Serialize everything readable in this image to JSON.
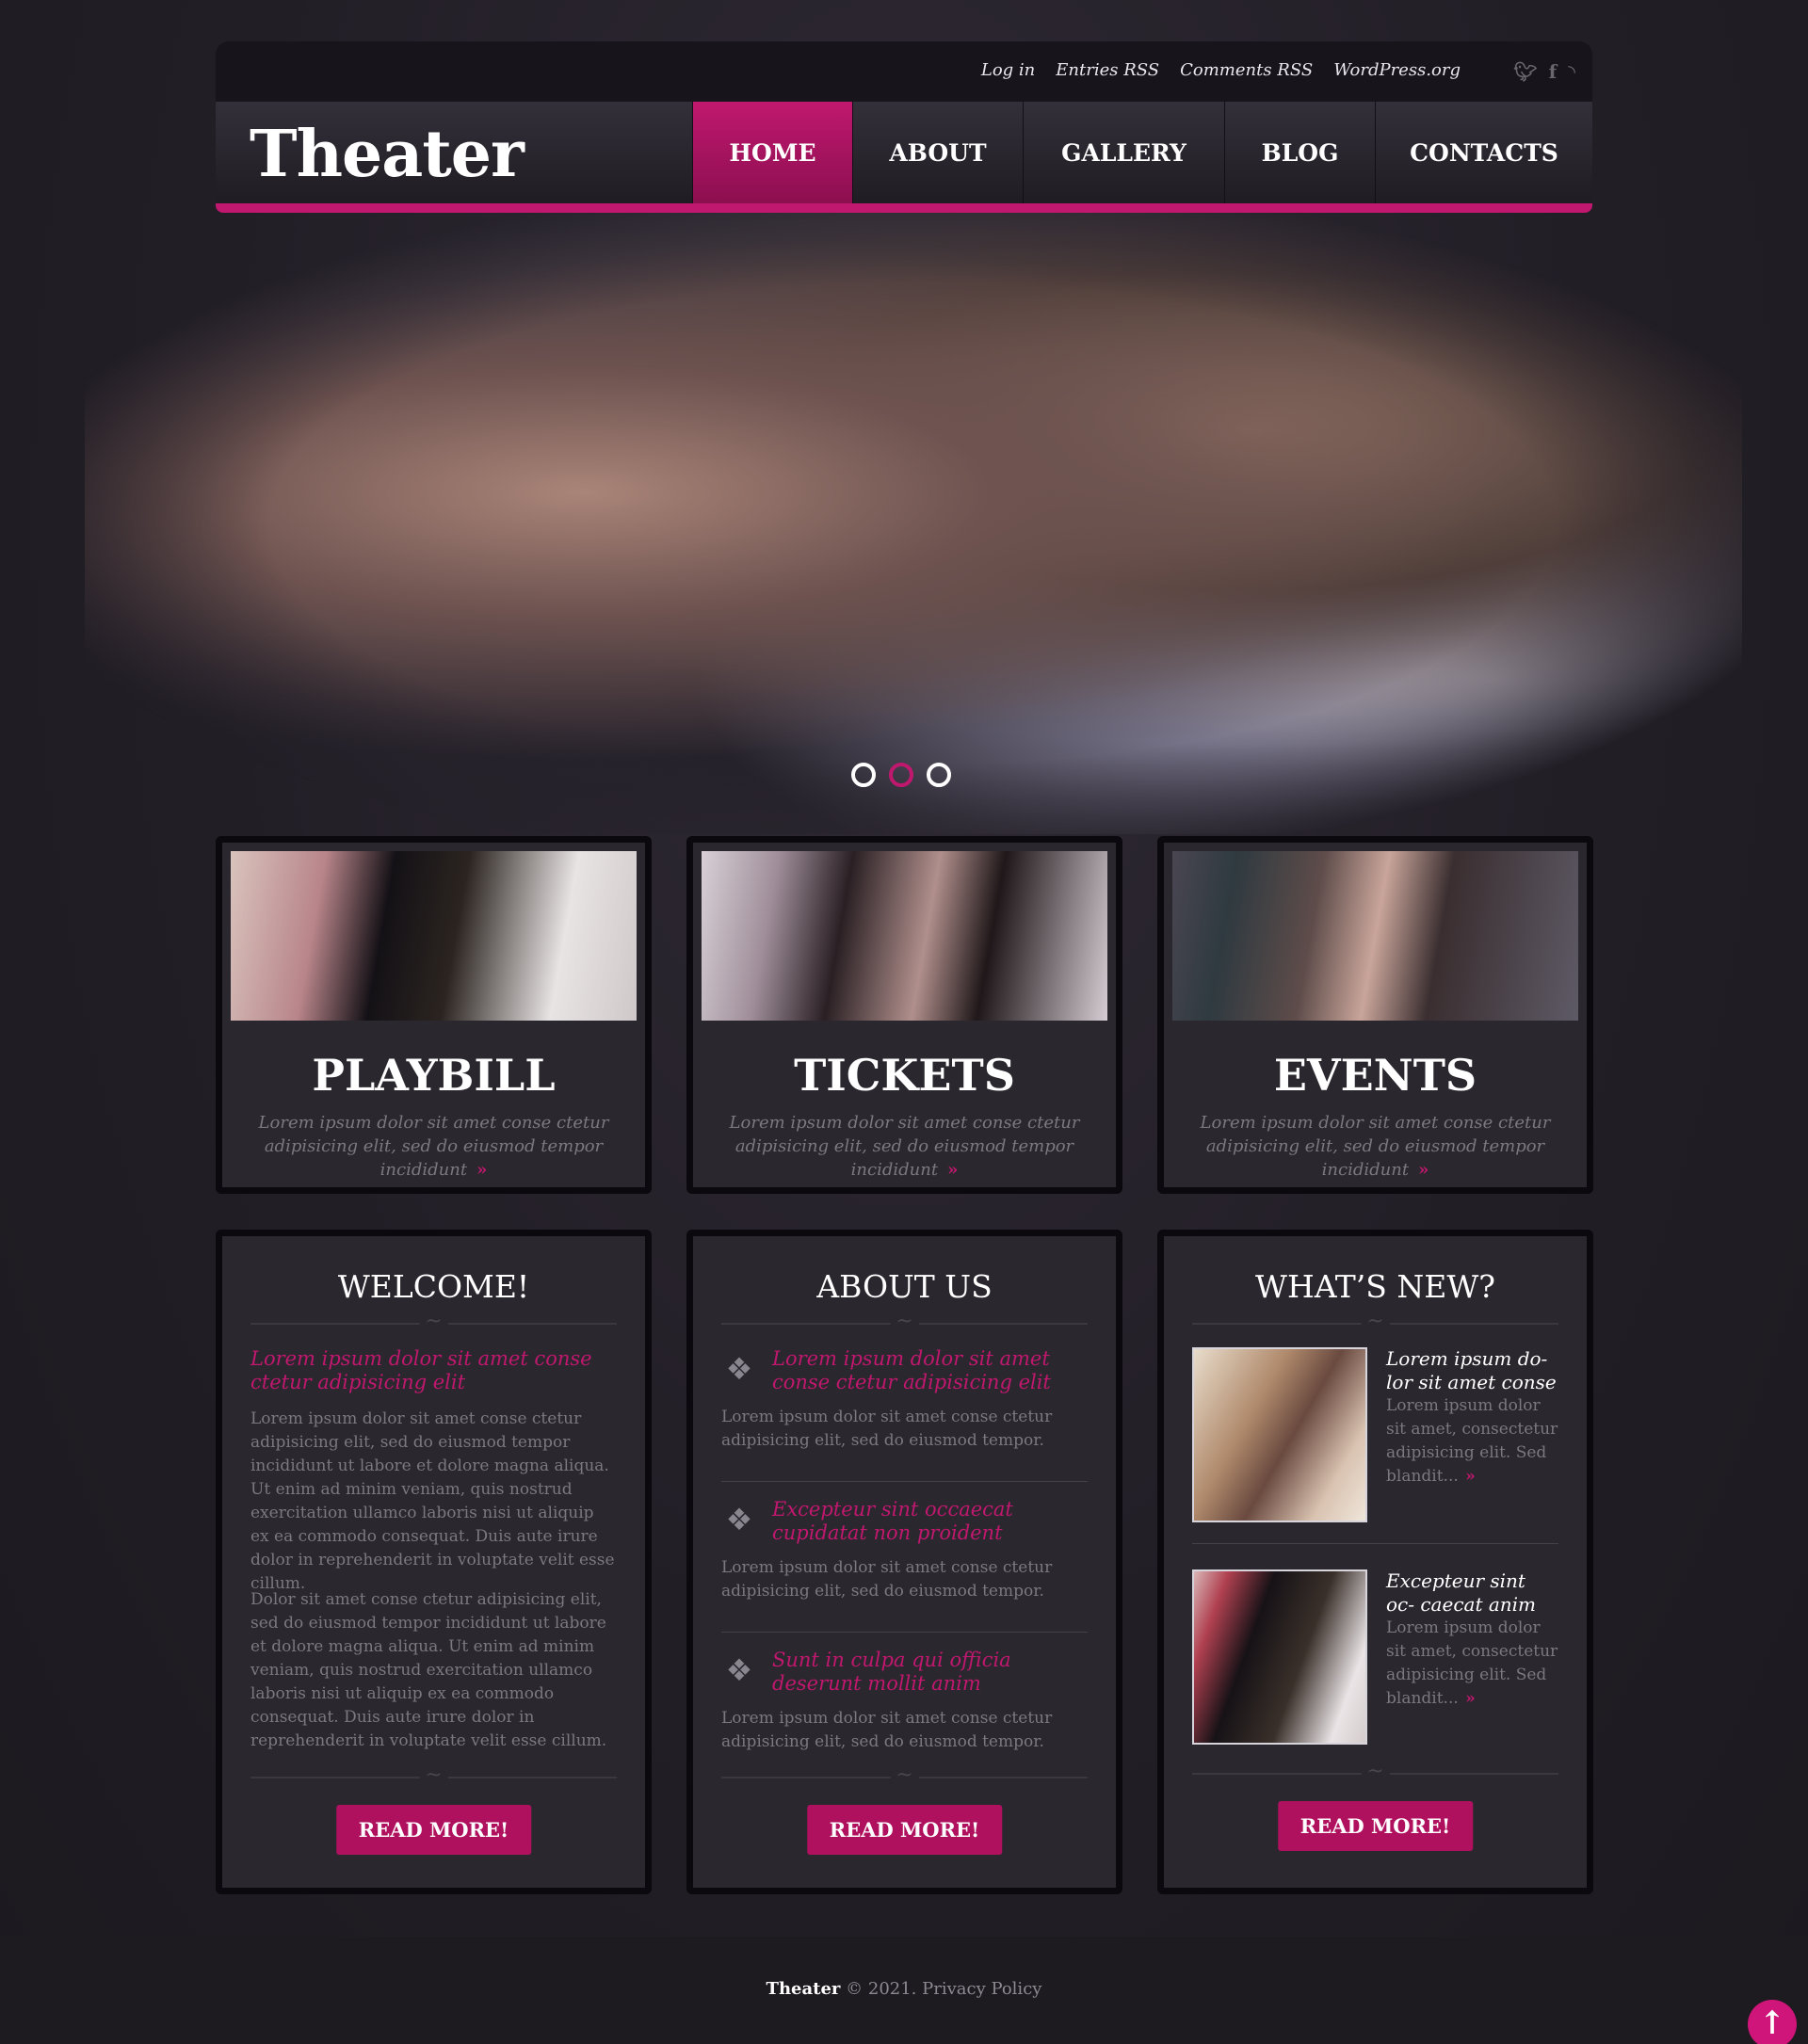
{
  "colors": {
    "accent": "#c0186e",
    "background": "#242028",
    "panel": "#2a272e"
  },
  "topbar": {
    "links": [
      "Log in",
      "Entries RSS",
      "Comments RSS",
      "WordPress.org"
    ],
    "social": [
      "twitter-icon",
      "facebook-icon",
      "rss-icon"
    ]
  },
  "header": {
    "logo": "Theater",
    "nav": [
      "HOME",
      "ABOUT",
      "GALLERY",
      "BLOG",
      "CONTACTS"
    ],
    "active_nav": "HOME"
  },
  "slider": {
    "dots": 3,
    "active_dot": 2
  },
  "features": [
    {
      "title": "PLAYBILL",
      "text": "Lorem ipsum dolor sit amet conse ctetur adipisicing elit, sed do eiusmod tempor incididunt"
    },
    {
      "title": "TICKETS",
      "text": "Lorem ipsum dolor sit amet conse ctetur adipisicing elit, sed do eiusmod tempor incididunt"
    },
    {
      "title": "EVENTS",
      "text": "Lorem ipsum dolor sit amet conse ctetur adipisicing elit, sed do eiusmod tempor incididunt"
    }
  ],
  "welcome": {
    "title": "WELCOME!",
    "lead": "Lorem ipsum dolor sit amet conse ctetur adipisicing elit",
    "p1": "Lorem ipsum dolor sit amet conse ctetur adipisicing elit, sed do eiusmod tempor incididunt ut labore et dolore magna aliqua. Ut enim ad minim veniam, quis nostrud exercitation ullamco laboris nisi ut aliquip ex ea commodo consequat. Duis aute irure dolor in reprehenderit in voluptate velit esse cillum.",
    "p2": "Dolor sit amet conse ctetur adipisicing elit, sed do eiusmod tempor incididunt ut labore et dolore magna aliqua. Ut enim ad minim veniam, quis nostrud exercitation ullamco laboris nisi ut aliquip ex ea commodo consequat. Duis aute irure dolor in reprehenderit in voluptate velit esse cillum.",
    "button": "READ MORE!"
  },
  "about": {
    "title": "ABOUT US",
    "items": [
      {
        "lead": "Lorem ipsum dolor sit amet conse ctetur adipisicing elit",
        "text": "Lorem ipsum dolor sit amet conse ctetur adipisicing elit, sed do eiusmod tempor."
      },
      {
        "lead": "Excepteur sint occaecat cupidatat non proident",
        "text": "Lorem ipsum dolor sit amet conse ctetur adipisicing elit, sed do eiusmod tempor."
      },
      {
        "lead": "Sunt in culpa qui officia deserunt mollit anim",
        "text": "Lorem ipsum dolor sit amet conse ctetur adipisicing elit, sed do eiusmod tempor."
      }
    ],
    "button": "READ MORE!"
  },
  "news": {
    "title": "WHAT’S NEW?",
    "items": [
      {
        "title": "Lorem ipsum do- lor sit amet conse",
        "text": "Lorem ipsum dolor sit amet, consectetur adipisicing elit. Sed blandit..."
      },
      {
        "title": "Excepteur sint oc- caecat anim",
        "text": "Lorem ipsum dolor sit amet, consectetur adipisicing elit. Sed blandit..."
      }
    ],
    "button": "READ MORE!"
  },
  "footer": {
    "brand": "Theater",
    "text": "© 2021. Privacy Policy"
  }
}
